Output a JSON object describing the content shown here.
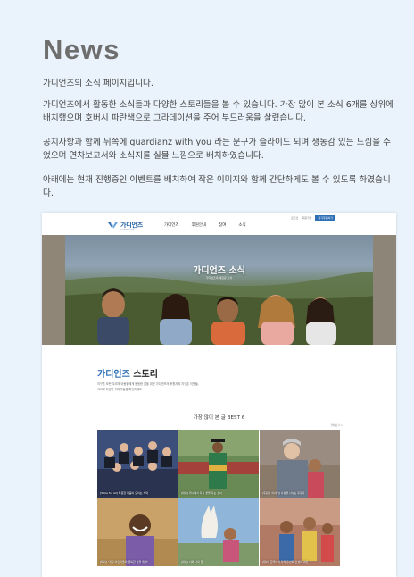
{
  "page": {
    "heading": "News",
    "paragraphs": [
      "가디언즈의 소식 페이지입니다.",
      "가디언즈에서 활동한 소식들과 다양한 스토리들을 볼 수 있습니다. 가장 많이 본 소식 6개를 상위에 배치했으며 호버시 파란색으로 그라데이션을 주어 부드러움을 살렸습니다.",
      "공지사항과 함께 뒤쪽에 guardianz with you 라는 문구가 슬라이드 되며 생동감 있는 느낌을 주었으며 연차보고서와 소식지를 실물 느낌으로 배치하였습니다.",
      "아래에는 현재 진행중인 이벤트를 배치하여 작은 이미지와 함께 간단하게도 볼 수 있도록 하였습니다."
    ]
  },
  "mock": {
    "logo": {
      "name": "가디언즈",
      "tagline": "GUARDIANZ"
    },
    "nav": [
      "가디언즈",
      "후원안내",
      "참여",
      "소식"
    ],
    "utility": {
      "links": [
        "로그인",
        "회원가입"
      ],
      "button": "정기후원하기"
    },
    "hero": {
      "title": "가디언즈 소식",
      "subtitle": "가디언즈의 새로운 소식"
    },
    "story": {
      "title_accent": "가디언즈",
      "title_rest": " 스토리",
      "desc_lines": [
        "지구촌 모든 우리의 아동들에게 동등한 삶을 위한 가디언즈의 후원자와 지구촌 이웃들,",
        "그리고 다양한 이야기들을 확인하세요"
      ]
    },
    "best": {
      "title": "가장 많이 본 글 BEST 6",
      "more": "전체보기 >"
    },
    "cards": [
      {
        "caption": "[Table for All] 따뜻한 마음이 모이는 식탁",
        "tag": "group-photo"
      },
      {
        "caption": "[대외] 카나에서 다시 꿈을 꾸는 소녀",
        "tag": "graduate"
      },
      {
        "caption": "[후원자 이야기] 사랑을 나누는 후원자",
        "tag": "elder"
      },
      {
        "caption": "[대외] \"지구 어린이들의 행복한 삶을 위해\"",
        "tag": "child-smile"
      },
      {
        "caption": "[대외] 너와 나의 꿈",
        "tag": "llama"
      },
      {
        "caption": "[대외] 한국에서 자라 두번째 인생의 씨앗",
        "tag": "kids-room"
      }
    ]
  },
  "colors": {
    "background": "#eaf3fb",
    "accent": "#2f6fb6",
    "heading": "#6e6e6e"
  }
}
